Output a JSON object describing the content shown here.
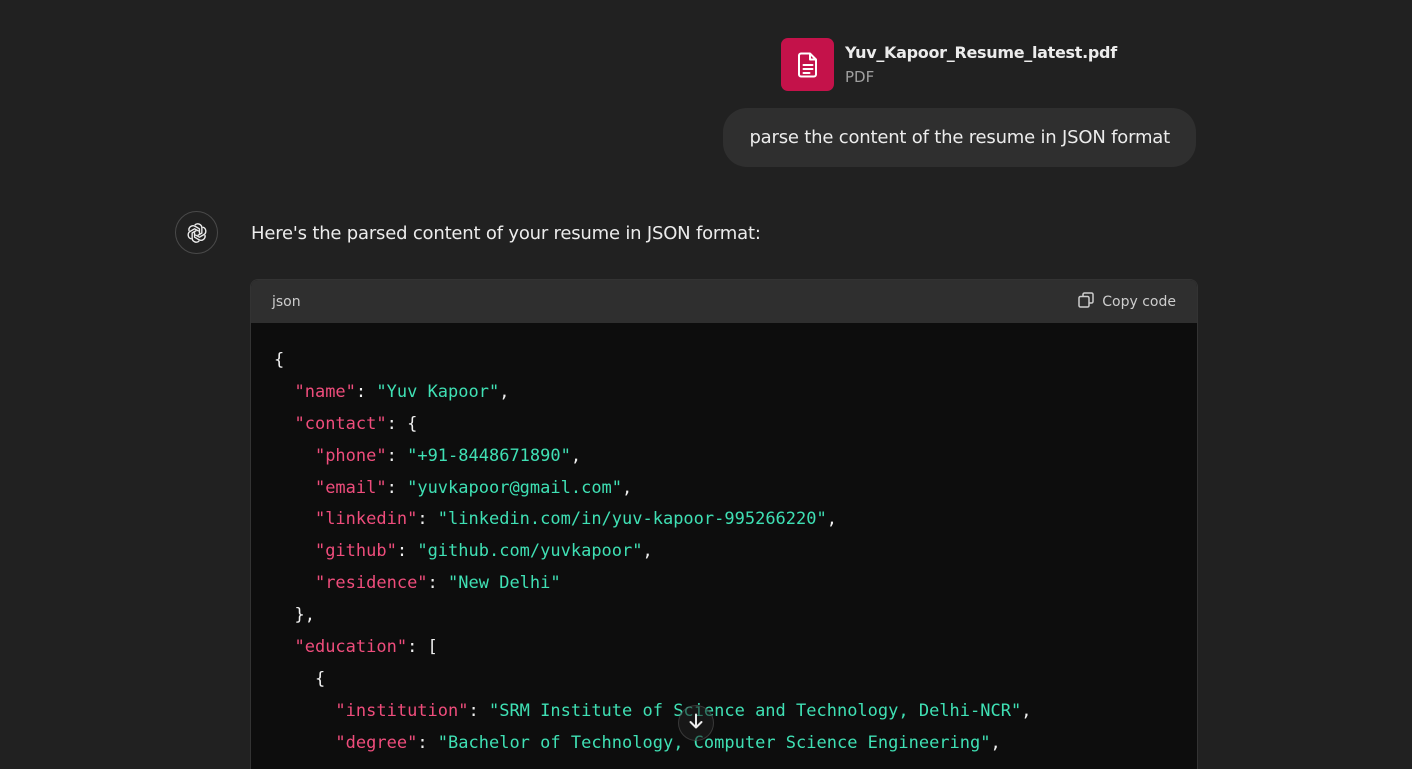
{
  "attachment": {
    "file_name": "Yuv_Kapoor_Resume_latest.pdf",
    "file_type": "PDF"
  },
  "user_message": "parse the content of the resume in JSON format",
  "assistant": {
    "intro": "Here's the parsed content of your resume in JSON format:"
  },
  "code_block": {
    "language": "json",
    "copy_label": "Copy code",
    "lines": [
      {
        "indent": 0,
        "tokens": [
          {
            "t": "p",
            "v": "{"
          }
        ]
      },
      {
        "indent": 1,
        "tokens": [
          {
            "t": "k",
            "v": "\"name\""
          },
          {
            "t": "p",
            "v": ": "
          },
          {
            "t": "s",
            "v": "\"Yuv Kapoor\""
          },
          {
            "t": "p",
            "v": ","
          }
        ]
      },
      {
        "indent": 1,
        "tokens": [
          {
            "t": "k",
            "v": "\"contact\""
          },
          {
            "t": "p",
            "v": ": {"
          }
        ]
      },
      {
        "indent": 2,
        "tokens": [
          {
            "t": "k",
            "v": "\"phone\""
          },
          {
            "t": "p",
            "v": ": "
          },
          {
            "t": "s",
            "v": "\"+91-8448671890\""
          },
          {
            "t": "p",
            "v": ","
          }
        ]
      },
      {
        "indent": 2,
        "tokens": [
          {
            "t": "k",
            "v": "\"email\""
          },
          {
            "t": "p",
            "v": ": "
          },
          {
            "t": "s",
            "v": "\"yuvkapoor@gmail.com\""
          },
          {
            "t": "p",
            "v": ","
          }
        ]
      },
      {
        "indent": 2,
        "tokens": [
          {
            "t": "k",
            "v": "\"linkedin\""
          },
          {
            "t": "p",
            "v": ": "
          },
          {
            "t": "s",
            "v": "\"linkedin.com/in/yuv-kapoor-995266220\""
          },
          {
            "t": "p",
            "v": ","
          }
        ]
      },
      {
        "indent": 2,
        "tokens": [
          {
            "t": "k",
            "v": "\"github\""
          },
          {
            "t": "p",
            "v": ": "
          },
          {
            "t": "s",
            "v": "\"github.com/yuvkapoor\""
          },
          {
            "t": "p",
            "v": ","
          }
        ]
      },
      {
        "indent": 2,
        "tokens": [
          {
            "t": "k",
            "v": "\"residence\""
          },
          {
            "t": "p",
            "v": ": "
          },
          {
            "t": "s",
            "v": "\"New Delhi\""
          }
        ]
      },
      {
        "indent": 1,
        "tokens": [
          {
            "t": "p",
            "v": "},"
          }
        ]
      },
      {
        "indent": 1,
        "tokens": [
          {
            "t": "k",
            "v": "\"education\""
          },
          {
            "t": "p",
            "v": ": ["
          }
        ]
      },
      {
        "indent": 2,
        "tokens": [
          {
            "t": "p",
            "v": "{"
          }
        ]
      },
      {
        "indent": 3,
        "tokens": [
          {
            "t": "k",
            "v": "\"institution\""
          },
          {
            "t": "p",
            "v": ": "
          },
          {
            "t": "s",
            "v": "\"SRM Institute of Science and Technology, Delhi-NCR\""
          },
          {
            "t": "p",
            "v": ","
          }
        ]
      },
      {
        "indent": 3,
        "tokens": [
          {
            "t": "k",
            "v": "\"degree\""
          },
          {
            "t": "p",
            "v": ": "
          },
          {
            "t": "s",
            "v": "\"Bachelor of Technology, Computer Science Engineering\""
          },
          {
            "t": "p",
            "v": ","
          }
        ]
      }
    ]
  },
  "icons": {
    "file": "document-icon",
    "avatar": "openai-logo-icon",
    "copy": "copy-icon",
    "scroll": "arrow-down-icon"
  },
  "colors": {
    "background": "#212121",
    "bubble": "#2f2f2f",
    "file_icon_bg": "#c4124a",
    "json_key": "#ef4d7c",
    "json_string": "#3fe0b4"
  }
}
